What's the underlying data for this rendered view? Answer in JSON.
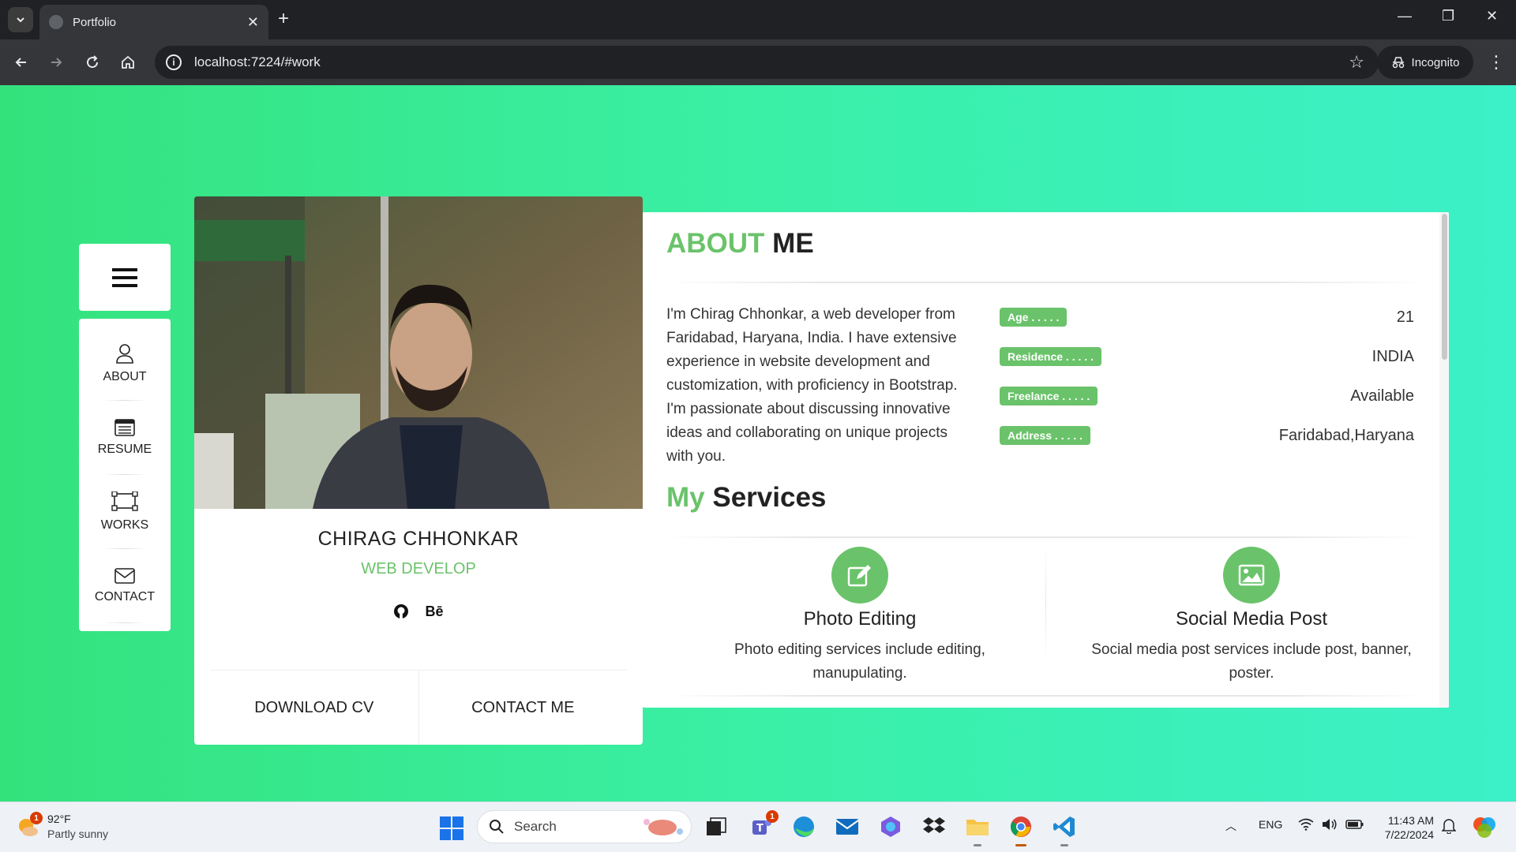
{
  "browser": {
    "tab_title": "Portfolio",
    "url": "localhost:7224/#work",
    "incognito_label": "Incognito"
  },
  "sidebar": {
    "items": [
      {
        "label": "ABOUT",
        "icon": "user-icon"
      },
      {
        "label": "RESUME",
        "icon": "document-list-icon"
      },
      {
        "label": "WORKS",
        "icon": "works-icon"
      },
      {
        "label": "CONTACT",
        "icon": "envelope-icon"
      }
    ]
  },
  "profile": {
    "name": "CHIRAG CHHONKAR",
    "role": "WEB DEVELOP",
    "behance_label": "Bē",
    "download_cv": "DOWNLOAD CV",
    "contact_me": "CONTACT ME"
  },
  "about": {
    "title_accent": "ABOUT",
    "title_rest": "ME",
    "bio": "I'm Chirag Chhonkar, a web developer from Faridabad, Haryana, India. I have extensive experience in website development and customization, with proficiency in Bootstrap. I'm passionate about discussing innovative ideas and collaborating on unique projects with you.",
    "info": [
      {
        "label": "Age . . . . .",
        "value": "21"
      },
      {
        "label": "Residence . . . . .",
        "value": "INDIA"
      },
      {
        "label": "Freelance . . . . .",
        "value": "Available"
      },
      {
        "label": "Address . . . . .",
        "value": "Faridabad,Haryana"
      }
    ]
  },
  "services": {
    "title_accent": "My",
    "title_rest": "Services",
    "items": [
      {
        "title": "Photo Editing",
        "desc": "Photo editing services include editing, manupulating."
      },
      {
        "title": "Social Media Post",
        "desc": "Social media post services include post, banner, poster."
      }
    ]
  },
  "taskbar": {
    "weather_temp": "92°F",
    "weather_cond": "Partly sunny",
    "weather_badge": "1",
    "search_label": "Search",
    "teams_badge": "1",
    "lang": "ENG",
    "time": "11:43 AM",
    "date": "7/22/2024"
  },
  "colors": {
    "accent_green": "#6ac36a",
    "page_gradient_start": "#34e27c",
    "page_gradient_end": "#3cf0c8"
  }
}
